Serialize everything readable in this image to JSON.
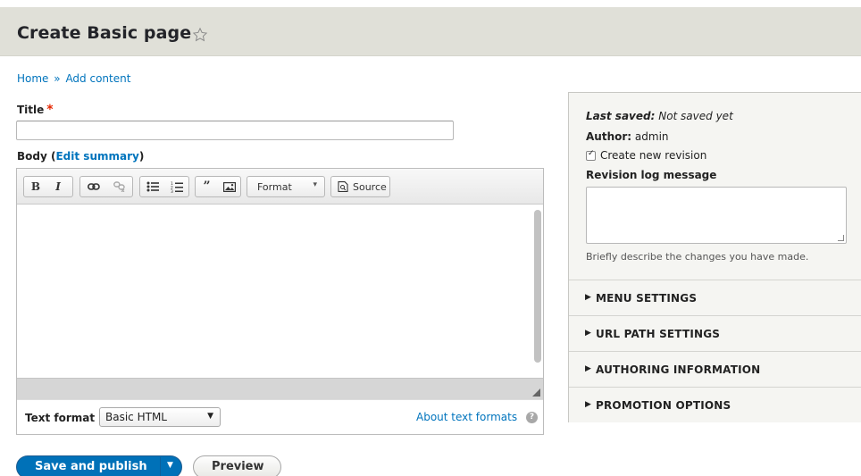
{
  "header": {
    "title": "Create Basic page"
  },
  "breadcrumb": {
    "home": "Home",
    "separator": "»",
    "current": "Add content"
  },
  "title_field": {
    "label": "Title",
    "required_mark": "*",
    "value": ""
  },
  "body_field": {
    "label": "Body",
    "edit_summary": "Edit summary",
    "open_paren": "(",
    "close_paren": ")"
  },
  "toolbar": {
    "bold": "B",
    "italic": "I",
    "format": "Format",
    "source": "Source"
  },
  "text_format": {
    "label": "Text format",
    "selected": "Basic HTML",
    "about": "About text formats",
    "help": "?"
  },
  "actions": {
    "save": "Save and publish",
    "preview": "Preview"
  },
  "sidebar": {
    "last_saved_label": "Last saved:",
    "last_saved_value": "Not saved yet",
    "author_label": "Author:",
    "author_value": "admin",
    "create_revision": "Create new revision",
    "revision_label": "Revision log message",
    "revision_value": "",
    "revision_desc": "Briefly describe the changes you have made.",
    "sections": [
      "MENU SETTINGS",
      "URL PATH SETTINGS",
      "AUTHORING INFORMATION",
      "PROMOTION OPTIONS"
    ]
  },
  "colors": {
    "link": "#0074bd",
    "primary": "#0071b8",
    "header_bg": "#e0e0d8",
    "required": "#e62600"
  }
}
